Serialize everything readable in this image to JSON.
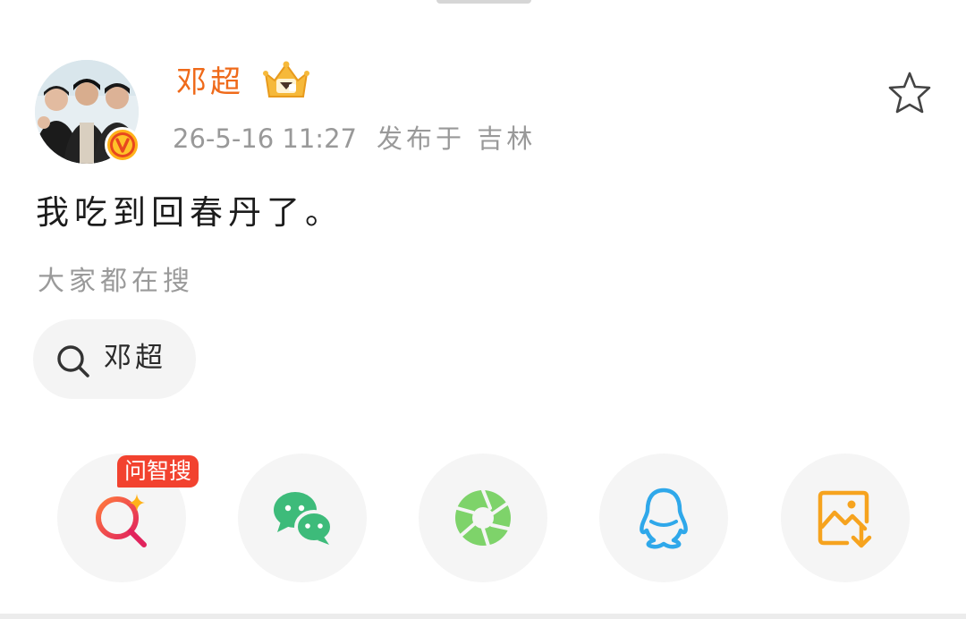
{
  "post": {
    "author": "邓超",
    "timestamp": "26-5-16 11:27",
    "location": "发布于 吉林",
    "text": "我吃到回春丹了。",
    "favorite_icon": "star-outline-icon",
    "avatar_badge": "verified-v-badge",
    "author_badge": "crown-badge-icon"
  },
  "related": {
    "label": "大家都在搜",
    "chips": [
      {
        "label": "邓超",
        "icon": "search-icon"
      }
    ]
  },
  "share": {
    "ai_tag": "问智搜",
    "buttons": [
      {
        "icon": "ai-search-icon",
        "color": "#e8335c"
      },
      {
        "icon": "wechat-icon",
        "color": "#3dbb7a"
      },
      {
        "icon": "moments-aperture-icon",
        "color": "#7ed36a"
      },
      {
        "icon": "qq-icon",
        "color": "#2fa8ea"
      },
      {
        "icon": "save-image-icon",
        "color": "#f6a31e"
      }
    ]
  },
  "colors": {
    "author_name": "#ef6a1a",
    "meta_text": "#999999",
    "ai_tag_bg": "#f2422f",
    "verified_badge": "#ffb21a"
  }
}
